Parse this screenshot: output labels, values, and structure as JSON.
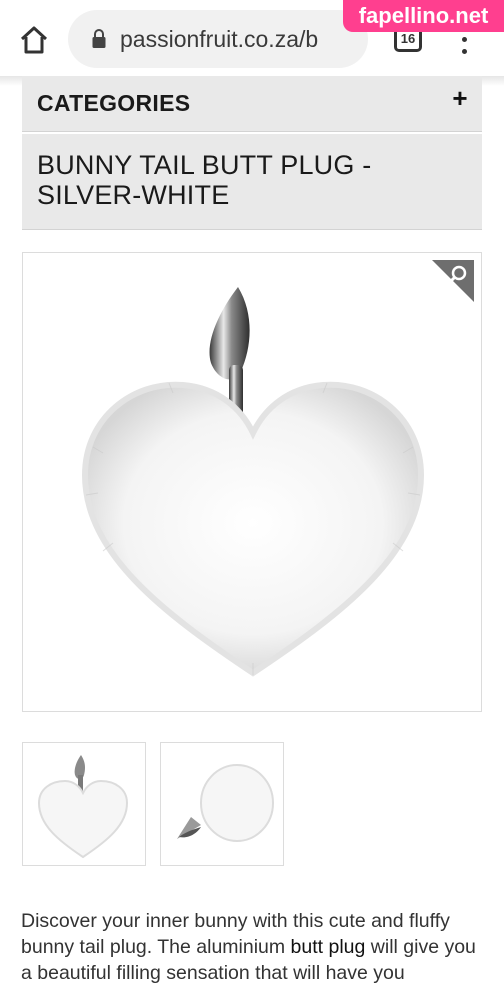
{
  "browser": {
    "url": "passionfruit.co.za/b",
    "tab_count": "16",
    "watermark": "fapellino.net"
  },
  "sidebar": {
    "categories_label": "CATEGORIES"
  },
  "product": {
    "title": "BUNNY TAIL BUTT PLUG - SILVER-WHITE",
    "description_before_link": "Discover your inner bunny with this cute and fluffy bunny tail plug. The aluminium ",
    "description_link": "butt plug",
    "description_after_link": " will give you a beautiful filling sensation that will have you"
  },
  "icons": {
    "home": "home-icon",
    "lock": "lock-icon",
    "tabs": "tabs-icon",
    "menu": "more-vert-icon",
    "expand": "plus-icon",
    "zoom": "magnifier-icon"
  },
  "colors": {
    "watermark_bg": "#ff3f8f",
    "panel_bg": "#e9e9e9",
    "url_bar_bg": "#f1f1f1"
  }
}
